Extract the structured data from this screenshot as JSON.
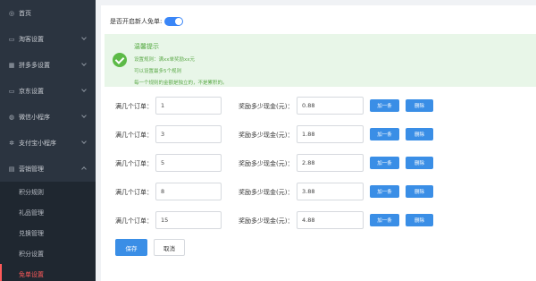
{
  "sidebar": {
    "items": [
      {
        "label": "首页",
        "icon": "dashboard-icon",
        "glyph": "◎",
        "chevron": false
      },
      {
        "label": "淘客设置",
        "icon": "folder-icon",
        "glyph": "▭",
        "chevron": true
      },
      {
        "label": "拼多多设置",
        "icon": "grid-icon",
        "glyph": "▦",
        "chevron": true
      },
      {
        "label": "京东设置",
        "icon": "card-icon",
        "glyph": "▭",
        "chevron": true
      },
      {
        "label": "微信小程序",
        "icon": "chat-icon",
        "glyph": "◍",
        "chevron": true
      },
      {
        "label": "支付宝小程序",
        "icon": "gear-icon",
        "glyph": "✲",
        "chevron": true
      },
      {
        "label": "营销管理",
        "icon": "share-icon",
        "glyph": "▤",
        "chevron": true,
        "expanded": true
      }
    ],
    "submenu": [
      {
        "label": "积分规则",
        "active": false
      },
      {
        "label": "礼品管理",
        "active": false
      },
      {
        "label": "兑换管理",
        "active": false
      },
      {
        "label": "积分设置",
        "active": false
      },
      {
        "label": "免单设置",
        "active": true
      }
    ]
  },
  "toggle": {
    "label": "是否开启新人免单:",
    "on": true
  },
  "tip": {
    "title": "温馨提示",
    "lines": [
      "设置规则：满xx单奖励xx元",
      "可以设置最多5个规则",
      "每一个规则的金额是独立的，不是累积的。"
    ]
  },
  "rules_form": {
    "orders_label": "满几个订单：",
    "reward_label": "奖励多少现金(元)：",
    "add_label": "加一条",
    "delete_label": "删除",
    "rows": [
      {
        "orders": "1",
        "reward": "0.88"
      },
      {
        "orders": "3",
        "reward": "1.88"
      },
      {
        "orders": "5",
        "reward": "2.88"
      },
      {
        "orders": "8",
        "reward": "3.88"
      },
      {
        "orders": "15",
        "reward": "4.88"
      }
    ]
  },
  "actions": {
    "save_label": "保存",
    "cancel_label": "取消"
  },
  "colors": {
    "accent": "#3a8ee6",
    "sidebar": "#2b3440",
    "active_item": "#ff5a5a",
    "tip_bg": "#e8f6e8"
  }
}
